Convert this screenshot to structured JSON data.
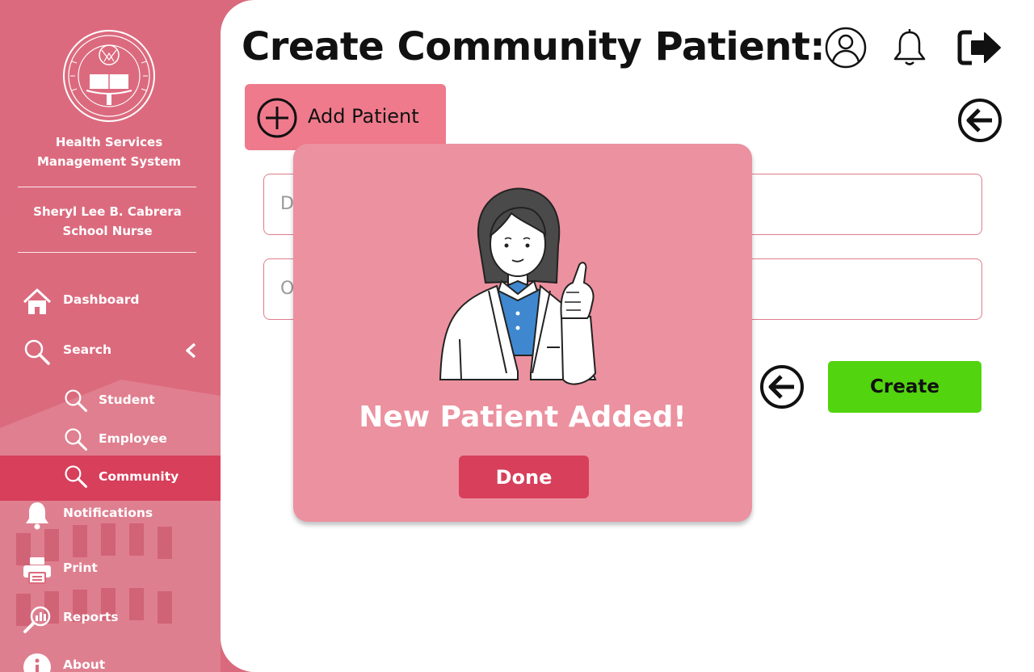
{
  "colors": {
    "sidebar": "#db6a7d",
    "sidebar_active": "#d73f5b",
    "tab": "#ef7a8c",
    "modal": "#ec919f",
    "create": "#52d40f",
    "done": "#d73f5b"
  },
  "sidebar": {
    "logo_icon": "university-seal-icon",
    "system_name_line1": "Health Services",
    "system_name_line2": "Management System",
    "user_name": "Sheryl Lee B. Cabrera",
    "user_role": "School Nurse",
    "items": [
      {
        "label": "Dashboard",
        "icon": "home-icon"
      },
      {
        "label": "Search",
        "icon": "search-icon"
      },
      {
        "label": "Student",
        "icon": "search-icon"
      },
      {
        "label": "Employee",
        "icon": "search-icon"
      },
      {
        "label": "Community",
        "icon": "search-icon"
      },
      {
        "label": "Notifications",
        "icon": "bell-icon"
      },
      {
        "label": "Print",
        "icon": "printer-icon"
      },
      {
        "label": "Reports",
        "icon": "reports-icon"
      },
      {
        "label": "About",
        "icon": "info-icon"
      }
    ]
  },
  "header": {
    "title": "Create Community Patient:"
  },
  "form": {
    "tab_label": "Add Patient",
    "field1_placeholder": "D",
    "field2_placeholder": "O",
    "create_label": "Create"
  },
  "modal": {
    "message": "New Patient Added!",
    "done_label": "Done"
  }
}
